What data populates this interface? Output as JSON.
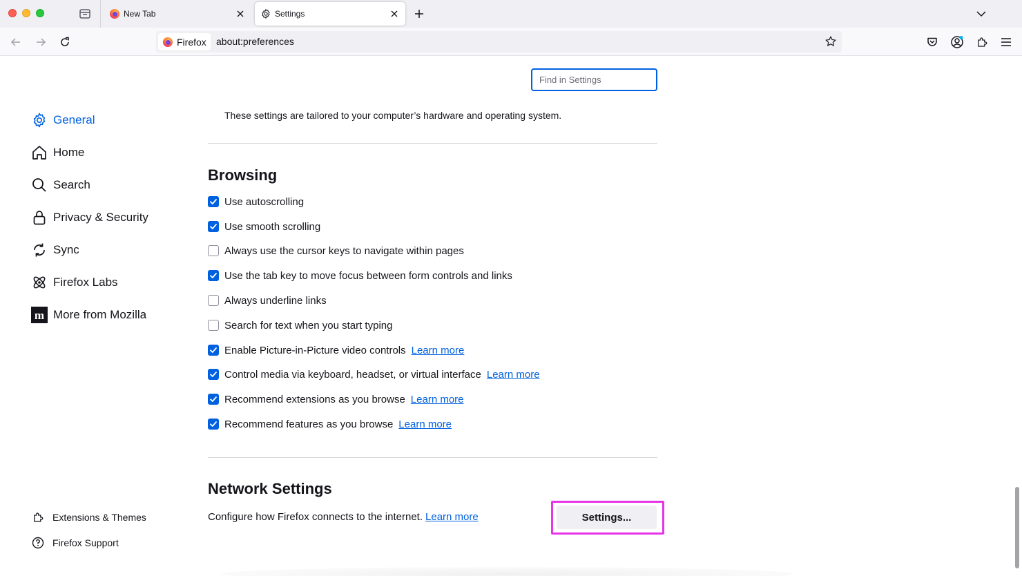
{
  "tabs": [
    {
      "title": "New Tab",
      "icon": "firefox-logo-icon",
      "active": false
    },
    {
      "title": "Settings",
      "icon": "gear-icon",
      "active": true
    }
  ],
  "navbar": {
    "identity_label": "Firefox",
    "url": "about:preferences"
  },
  "search": {
    "placeholder": "Find in Settings"
  },
  "sidebar": {
    "items": [
      {
        "label": "General",
        "icon": "gear-icon",
        "selected": true
      },
      {
        "label": "Home",
        "icon": "home-icon",
        "selected": false
      },
      {
        "label": "Search",
        "icon": "search-icon",
        "selected": false
      },
      {
        "label": "Privacy & Security",
        "icon": "lock-icon",
        "selected": false
      },
      {
        "label": "Sync",
        "icon": "sync-icon",
        "selected": false
      },
      {
        "label": "Firefox Labs",
        "icon": "labs-icon",
        "selected": false
      },
      {
        "label": "More from Mozilla",
        "icon": "mozilla-icon",
        "selected": false
      }
    ],
    "footer": [
      {
        "label": "Extensions & Themes",
        "icon": "puzzle-icon"
      },
      {
        "label": "Firefox Support",
        "icon": "help-icon"
      }
    ]
  },
  "performance": {
    "description": "These settings are tailored to your computer’s hardware and operating system."
  },
  "browsing": {
    "heading": "Browsing",
    "options": [
      {
        "label": "Use autoscrolling",
        "checked": true,
        "link": ""
      },
      {
        "label": "Use smooth scrolling",
        "checked": true,
        "link": ""
      },
      {
        "label": "Always use the cursor keys to navigate within pages",
        "checked": false,
        "link": ""
      },
      {
        "label": "Use the tab key to move focus between form controls and links",
        "checked": true,
        "link": ""
      },
      {
        "label": "Always underline links",
        "checked": false,
        "link": ""
      },
      {
        "label": "Search for text when you start typing",
        "checked": false,
        "link": ""
      },
      {
        "label": "Enable Picture-in-Picture video controls",
        "checked": true,
        "link": "Learn more"
      },
      {
        "label": "Control media via keyboard, headset, or virtual interface",
        "checked": true,
        "link": "Learn more"
      },
      {
        "label": "Recommend extensions as you browse",
        "checked": true,
        "link": "Learn more"
      },
      {
        "label": "Recommend features as you browse",
        "checked": true,
        "link": "Learn more"
      }
    ]
  },
  "network": {
    "heading": "Network Settings",
    "description": "Configure how Firefox connects to the internet.",
    "link": "Learn more",
    "button_label": "Settings..."
  },
  "colors": {
    "accent": "#0061e0",
    "highlight": "#e533e5"
  }
}
